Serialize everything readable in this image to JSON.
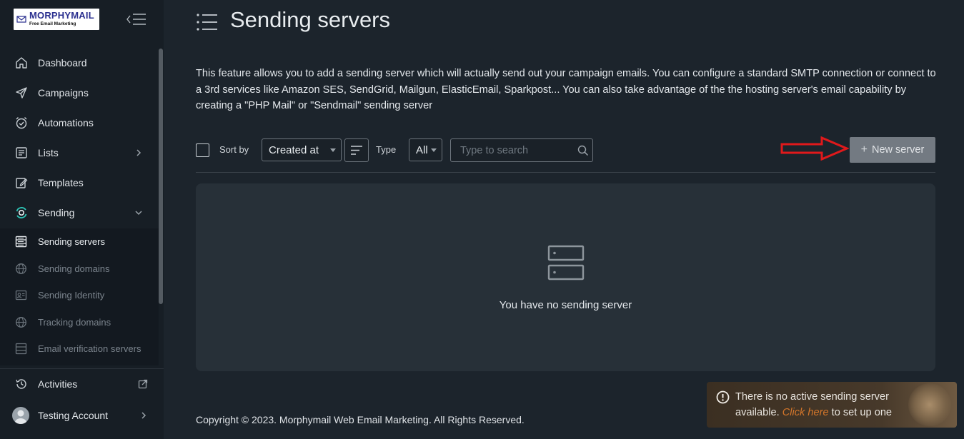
{
  "brand": {
    "title": "MORPHYMAIL",
    "subtitle": "Free Email Marketing"
  },
  "sidebar": {
    "items": [
      {
        "label": "Dashboard",
        "icon": "home-icon"
      },
      {
        "label": "Campaigns",
        "icon": "send-icon"
      },
      {
        "label": "Automations",
        "icon": "alarm-clock-icon"
      },
      {
        "label": "Lists",
        "icon": "list-box-icon"
      },
      {
        "label": "Templates",
        "icon": "edit-template-icon"
      },
      {
        "label": "Sending",
        "icon": "sending-icon"
      }
    ],
    "submenu": [
      {
        "label": "Sending servers",
        "icon": "server-icon",
        "active": true
      },
      {
        "label": "Sending domains",
        "icon": "globe-icon"
      },
      {
        "label": "Sending Identity",
        "icon": "identity-icon"
      },
      {
        "label": "Tracking domains",
        "icon": "globe-icon"
      },
      {
        "label": "Email verification servers",
        "icon": "server-icon"
      }
    ],
    "activities": "Activities",
    "account": "Testing Account"
  },
  "page": {
    "title": "Sending servers",
    "description": "This feature allows you to add a sending server which will actually send out your campaign emails. You can configure a standard SMTP connection or connect to a 3rd services like Amazon SES, SendGrid, Mailgun, ElasticEmail, Sparkpost... You can also take advantage of the the hosting server's email capability by creating a \"PHP Mail\" or \"Sendmail\" sending server"
  },
  "toolbar": {
    "sort_label": "Sort by",
    "sort_value": "Created at",
    "type_label": "Type",
    "type_value": "All",
    "search_placeholder": "Type to search",
    "new_button": "New server",
    "new_button_plus": "+"
  },
  "empty_state": {
    "text": "You have no sending server"
  },
  "footer": {
    "copyright": "Copyright © 2023. Morphymail Web Email Marketing. All Rights Reserved."
  },
  "toast": {
    "text_before": "There is no active sending server available. ",
    "link": "Click here",
    "text_after": " to set up one"
  },
  "colors": {
    "sidebar_bg": "#171e25",
    "main_bg": "#1c242c",
    "panel_bg": "#273038",
    "accent_teal": "#2ec4b6",
    "arrow_red": "#e0191b",
    "toast_link": "#d4762a"
  }
}
